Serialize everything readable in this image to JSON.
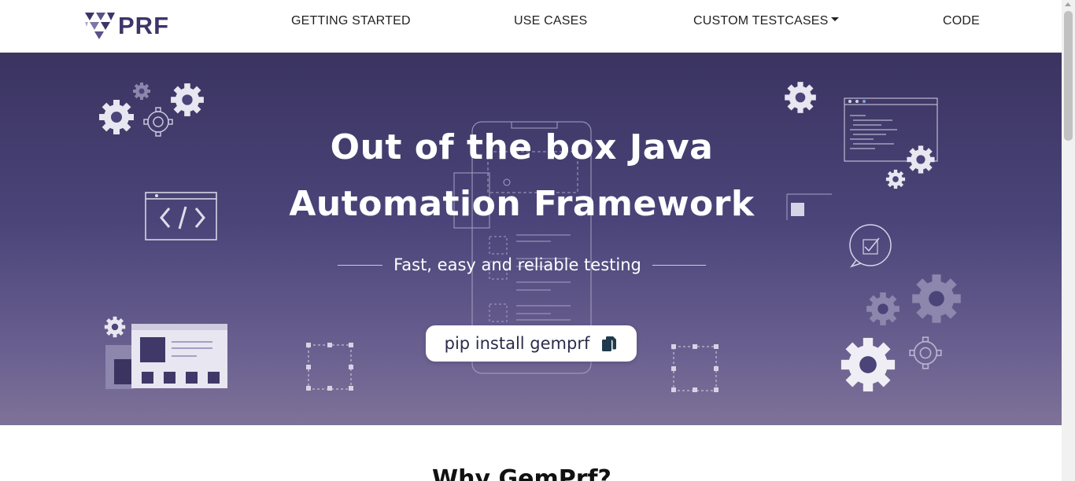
{
  "nav": {
    "logo_text": "PRF",
    "items": [
      {
        "label": "GETTING STARTED"
      },
      {
        "label": "USE CASES"
      },
      {
        "label": "CUSTOM TESTCASES"
      },
      {
        "label": "CODE"
      }
    ]
  },
  "hero": {
    "title_line1": "Out of the box Java",
    "title_line2": "Automation Framework",
    "subtitle": "Fast, easy and reliable testing",
    "install_command": "pip install gemprf"
  },
  "section": {
    "heading": "Why GemPrf?"
  },
  "colors": {
    "hero_top": "#3b3461",
    "hero_bottom": "#7e7298",
    "brand": "#3d3568"
  }
}
